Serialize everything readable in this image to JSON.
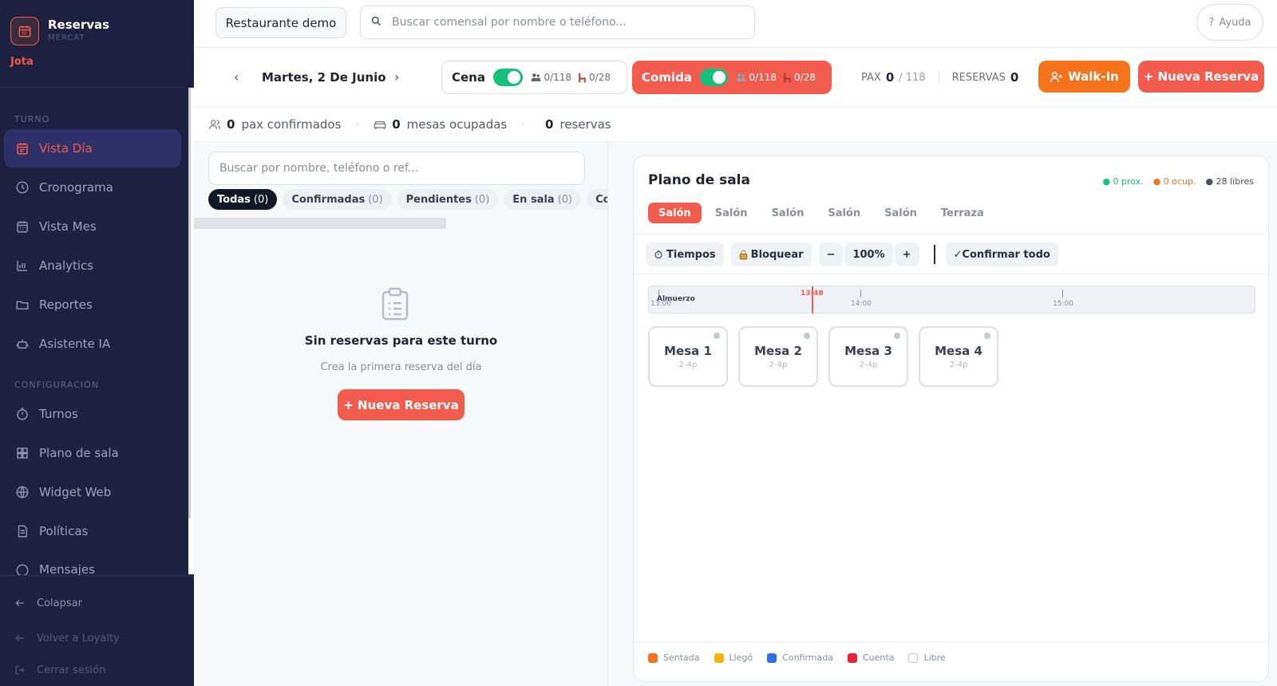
{
  "sidebar": {
    "brand_title": "Reservas",
    "brand_sub": "MERCAT",
    "user": "Jota",
    "section_turno": "TURNO",
    "section_config": "CONFIGURACIÓN",
    "items": [
      {
        "label": "Vista Día"
      },
      {
        "label": "Cronograma"
      },
      {
        "label": "Vista Mes"
      },
      {
        "label": "Analytics"
      },
      {
        "label": "Reportes"
      },
      {
        "label": "Asistente IA"
      },
      {
        "label": "Turnos"
      },
      {
        "label": "Plano de sala"
      },
      {
        "label": "Widget Web"
      },
      {
        "label": "Políticas"
      },
      {
        "label": "Mensajes"
      }
    ],
    "collapse": "Colapsar",
    "back_loyalty": "Volver a Loyalty",
    "logout": "Cerrar sesión"
  },
  "topbar": {
    "restaurant": "Restaurante demo",
    "search_placeholder": "Buscar comensal por nombre o teléfono...",
    "help": "Ayuda"
  },
  "daybar": {
    "prev": "‹",
    "next": "›",
    "date": "Martes, 2 De Junio",
    "cena": {
      "name": "Cena",
      "pax": "0/118",
      "tables": "0/28"
    },
    "comida": {
      "name": "Comida",
      "pax": "0/118",
      "tables": "0/28"
    },
    "pax_label": "PAX",
    "pax_value": "0",
    "pax_total": "/ 118",
    "reservas_label": "RESERVAS",
    "reservas_value": "0",
    "walkin": "Walk-In",
    "nueva": "+ Nueva Reserva"
  },
  "summary": {
    "pax_value": "0",
    "pax_label": "pax confirmados",
    "mesas_value": "0",
    "mesas_label": "mesas ocupadas",
    "reservas_value": "0",
    "reservas_label": "reservas"
  },
  "list": {
    "search_placeholder": "Buscar por nombre, teléfono o ref...",
    "chips": [
      {
        "label": "Todas",
        "count": "(0)"
      },
      {
        "label": "Confirmadas",
        "count": "(0)"
      },
      {
        "label": "Pendientes",
        "count": "(0)"
      },
      {
        "label": "En sala",
        "count": "(0)"
      },
      {
        "label": "Completadas",
        "count": ""
      }
    ],
    "empty_title": "Sin reservas para este turno",
    "empty_sub": "Crea la primera reserva del día",
    "empty_button": "+ Nueva Reserva"
  },
  "floor": {
    "title": "Plano de sala",
    "legend_top": {
      "prox": "● 0 prox.",
      "ocup": "● 0 ocup.",
      "libres": "● 28 libres"
    },
    "rooms": [
      "Salón",
      "Salón",
      "Salón",
      "Salón",
      "Salón",
      "Terraza"
    ],
    "tools": {
      "tiempos": "Tiempos",
      "bloquear": "Bloquear",
      "minus": "−",
      "zoom": "100%",
      "plus": "+",
      "confirm": "✓Confirmar todo"
    },
    "timeline": {
      "shift": "Almuerzo",
      "t1": "13:00",
      "now": "13:48",
      "t2": "14:00",
      "t3": "15:00"
    },
    "tables": [
      {
        "name": "Mesa 1",
        "cap": "2-4p"
      },
      {
        "name": "Mesa 2",
        "cap": "2-4p"
      },
      {
        "name": "Mesa 3",
        "cap": "2-4p"
      },
      {
        "name": "Mesa 4",
        "cap": "2-4p"
      }
    ],
    "legend": [
      {
        "label": "Sentada",
        "color": "#f5731c"
      },
      {
        "label": "Llegó",
        "color": "#f5b40a"
      },
      {
        "label": "Confirmada",
        "color": "#2f6fe8"
      },
      {
        "label": "Cuenta",
        "color": "#e8243a"
      },
      {
        "label": "Libre",
        "color": "#ffffff"
      }
    ]
  },
  "colors": {
    "accent": "#f25c4e",
    "walkin": "#f5731c",
    "toggle": "#17c07a",
    "sidebar": "#1e2040"
  }
}
